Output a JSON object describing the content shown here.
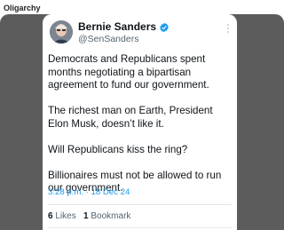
{
  "page": {
    "title": "Oligarchy"
  },
  "tweet": {
    "author_name": "Bernie Sanders",
    "handle": "@SenSanders",
    "paragraphs": [
      "Democrats and Republicans spent months negotiating a bipartisan agreement to fund our government.",
      "The richest man on Earth, President Elon Musk, doesn’t like it.",
      "Will Republicans kiss the ring?",
      "Billionaires must not be allowed to run our government."
    ],
    "time": "3:28 p.m.",
    "separator": "·",
    "date": "18 Dec 24",
    "likes_count": "6",
    "likes_label": "Likes",
    "bookmarks_count": "1",
    "bookmarks_label": "Bookmark"
  },
  "colors": {
    "background_frame": "#5c5c5c",
    "link_blue": "#1d9bf0",
    "verified_blue": "#1d9bf0",
    "text_primary": "#0f1419",
    "text_secondary": "#536471"
  },
  "icons": {
    "verified": "verified-badge-icon",
    "more": "more-options-icon"
  }
}
